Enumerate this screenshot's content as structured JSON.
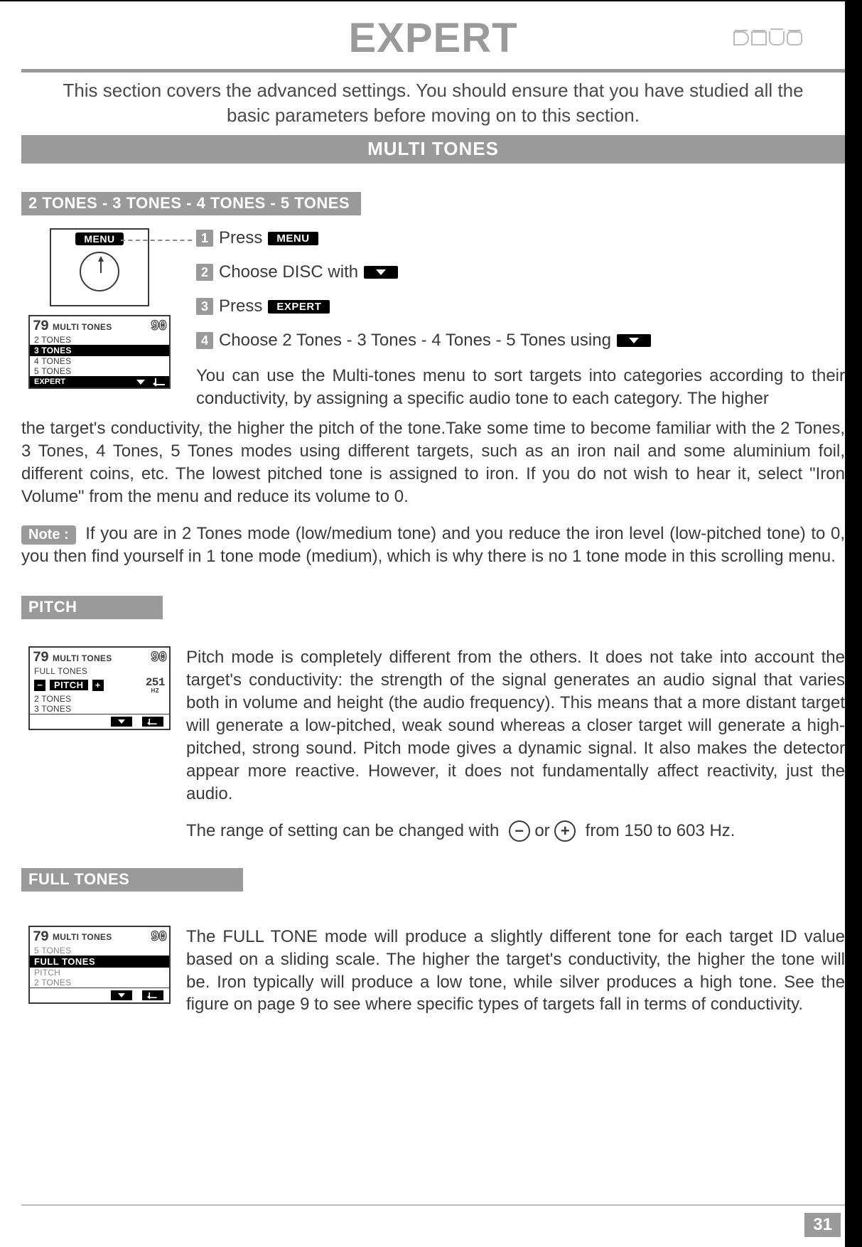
{
  "page_number": "31",
  "brand": "DEUS",
  "title": "EXPERT",
  "intro": "This section covers the advanced settings. You should ensure that you have studied all the basic parameters before moving on to this section.",
  "section_multi_tones": "MULTI TONES",
  "sub_tones": "2 TONES - 3 TONES - 4 TONES - 5 TONES",
  "menu_graphic_label": "MENU",
  "device1": {
    "left_val": "79",
    "header": "MULTI  TONES",
    "right_val": "90",
    "items": [
      "2 TONES",
      "3 TONES",
      "4 TONES",
      "5 TONES"
    ],
    "selected": "3 TONES",
    "footer_label": "EXPERT"
  },
  "steps": {
    "s1_num": "1",
    "s1_a": "Press",
    "s1_pill": "MENU",
    "s2_num": "2",
    "s2_a": "Choose DISC  with",
    "s3_num": "3",
    "s3_a": "Press",
    "s3_pill": "EXPERT",
    "s4_num": "4",
    "s4_a": "Choose 2 Tones - 3 Tones - 4 Tones - 5 Tones using"
  },
  "para_tones_lead": "You can use the Multi-tones menu to sort targets into categories according to their conductivity, by assigning a specific audio tone to each category. The higher",
  "para_tones": "the target's conductivity, the higher the pitch of the tone.Take some time to become familiar with the 2 Tones, 3 Tones, 4 Tones, 5 Tones modes using different targets, such as an iron nail and some aluminium foil, different coins, etc. The lowest pitched tone is assigned to iron. If you do not wish to hear it, select \"Iron Volume\" from the menu and reduce its volume to 0.",
  "note_label": "Note :",
  "note_text": "If you are in 2 Tones mode (low/medium tone) and you reduce the iron level (low-pitched tone) to 0, you then find yourself in 1 tone mode (medium), which is why there is no 1 tone mode in this scrolling menu.",
  "sub_pitch": "PITCH",
  "pitch_device": {
    "left_val": "79",
    "header": "MULTI  TONES",
    "right_val": "90",
    "above": "FULL TONES",
    "selected": "PITCH",
    "below": [
      "2 TONES",
      "3 TONES"
    ],
    "hz_val": "251",
    "hz_unit": "HZ"
  },
  "pitch_para": "Pitch mode is completely different from the others. It does not take into account the target's conductivity: the strength of the signal generates an audio signal that varies both in volume and height (the audio frequency). This means that a more distant target will generate a low-pitched, weak sound whereas a closer target will generate a high-pitched, strong sound. Pitch mode gives a dynamic signal. It also makes the detector appear more reactive. However, it does not fundamentally affect reactivity, just the audio.",
  "pitch_range_a": "The range of setting can be changed with",
  "pitch_range_b": "or",
  "pitch_range_c": "from 150 to 603 Hz.",
  "sub_fulltones": "FULL TONES",
  "full_device": {
    "left_val": "79",
    "header": "MULTI  TONES",
    "right_val": "90",
    "above": "5 TONES",
    "selected": "FULL TONES",
    "below": [
      "PITCH",
      "2 TONES"
    ]
  },
  "full_para": "The FULL TONE mode will produce a slightly different tone for each target ID value based on a sliding scale.  The higher the target's conductivity, the higher the tone will be.  Iron typically will produce a low tone, while silver produces a high tone.  See the figure on page 9 to see where specific types of targets fall in terms of conductivity."
}
